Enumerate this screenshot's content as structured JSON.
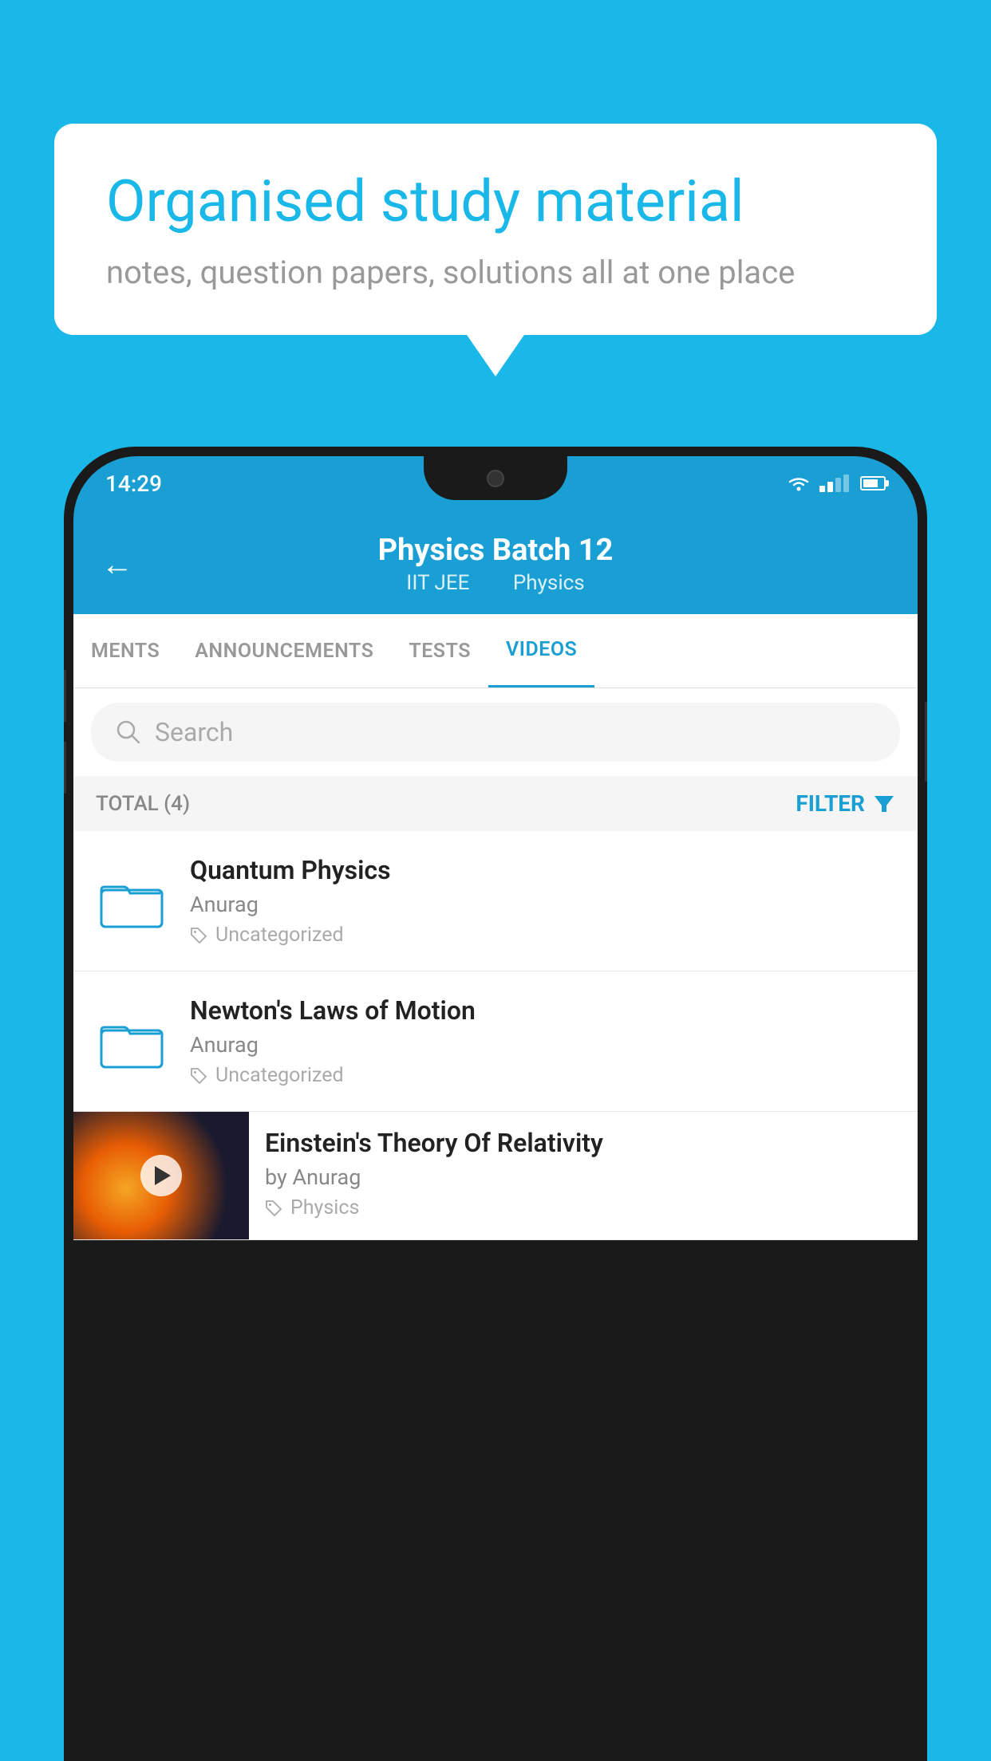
{
  "background_color": "#1ab8e8",
  "speech_bubble": {
    "headline": "Organised study material",
    "subtext": "notes, question papers, solutions all at one place"
  },
  "phone": {
    "status_bar": {
      "time": "14:29"
    },
    "header": {
      "title": "Physics Batch 12",
      "subtitle_part1": "IIT JEE",
      "subtitle_part2": "Physics",
      "back_label": "←"
    },
    "tabs": [
      {
        "label": "MENTS",
        "active": false
      },
      {
        "label": "ANNOUNCEMENTS",
        "active": false
      },
      {
        "label": "TESTS",
        "active": false
      },
      {
        "label": "VIDEOS",
        "active": true
      }
    ],
    "search": {
      "placeholder": "Search"
    },
    "filter_row": {
      "total_label": "TOTAL (4)",
      "filter_label": "FILTER"
    },
    "videos": [
      {
        "type": "folder",
        "title": "Quantum Physics",
        "author": "Anurag",
        "tag": "Uncategorized"
      },
      {
        "type": "folder",
        "title": "Newton's Laws of Motion",
        "author": "Anurag",
        "tag": "Uncategorized"
      },
      {
        "type": "video",
        "title": "Einstein's Theory Of Relativity",
        "author": "by Anurag",
        "tag": "Physics"
      }
    ]
  }
}
